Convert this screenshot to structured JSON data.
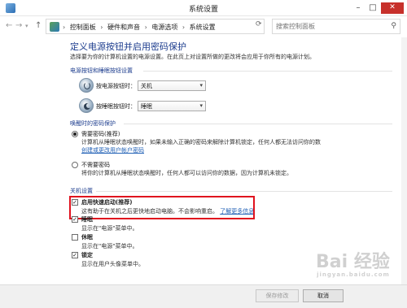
{
  "window": {
    "title": "系统设置",
    "controls": {
      "minimize": "–",
      "maximize": "□",
      "close": "✕"
    }
  },
  "address": {
    "crumbs": [
      "控制面板",
      "硬件和声音",
      "电源选项",
      "系统设置"
    ],
    "separator": "›",
    "search_placeholder": "搜索控制面板"
  },
  "page": {
    "heading": "定义电源按钮并启用密码保护",
    "description": "选择要为你的计算机设置的电源设置。在此页上对设置所做的更改将会应用于你所有的电源计划。"
  },
  "buttons_section": {
    "title": "电源按钮和睡眠按钮设置",
    "power_label": "按电源按钮时：",
    "power_value": "关机",
    "sleep_label": "按睡眠按钮时：",
    "sleep_value": "睡眠"
  },
  "wake_section": {
    "title": "唤醒时的密码保护",
    "require_title": "需要密码(推荐)",
    "require_desc": "计算机从睡眠状态唤醒时，如果未输入正确的密码来解除计算机锁定，任何人都无法访问你的数",
    "require_link": "创建或更改用户帐户密码",
    "norequire_title": "不需要密码",
    "norequire_desc": "将你的计算机从睡眠状态唤醒时，任何人都可以访问你的数据，因为计算机未锁定。"
  },
  "shutdown_section": {
    "title": "关机设置",
    "fast_title": "启用快速启动(推荐)",
    "fast_desc": "这有助于在关机之后更快地启动电脑。不会影响重启。",
    "fast_link": "了解更多信息",
    "sleep_title": "睡眠",
    "sleep_desc": "显示在\"电源\"菜单中。",
    "hibernate_title": "休眠",
    "hibernate_desc": "显示在\"电源\"菜单中。",
    "lock_title": "锁定",
    "lock_desc": "显示在用户头像菜单中。"
  },
  "footer": {
    "save": "保存修改",
    "cancel": "取消"
  },
  "watermark": {
    "text": "Bai 经验",
    "sub": "jingyan.baidu.com"
  }
}
